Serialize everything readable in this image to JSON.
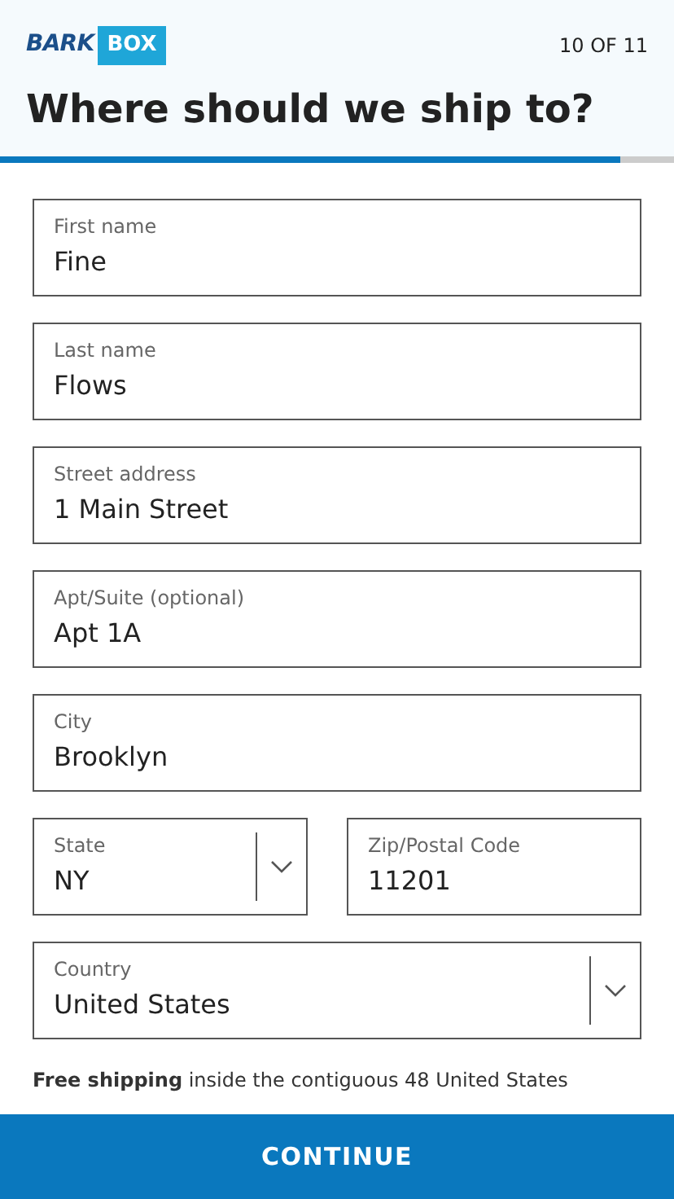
{
  "header": {
    "logo": {
      "word1": "BARK",
      "word2": "BOX"
    },
    "step": "10 OF 11",
    "title": "Where should we ship to?",
    "progress": {
      "level": 0.92
    }
  },
  "rows": [
    [
      {
        "kind": "text",
        "label": "First name",
        "value": "Fine"
      }
    ],
    [
      {
        "kind": "text",
        "label": "Last name",
        "value": "Flows"
      }
    ],
    [
      {
        "kind": "text",
        "label": "Street address",
        "value": "1 Main Street"
      }
    ],
    [
      {
        "kind": "text",
        "label": "Apt/Suite (optional)",
        "value": "Apt 1A"
      }
    ],
    [
      {
        "kind": "text",
        "label": "City",
        "value": "Brooklyn"
      }
    ],
    [
      {
        "kind": "select",
        "label": "State",
        "value": "NY"
      },
      {
        "kind": "text",
        "label": "Zip/Postal Code",
        "value": "11201"
      }
    ],
    [
      {
        "kind": "select",
        "label": "Country",
        "value": "United States"
      }
    ]
  ],
  "note": "**Free shipping** inside the contiguous 48 United States",
  "continue_button": "CONTINUE"
}
